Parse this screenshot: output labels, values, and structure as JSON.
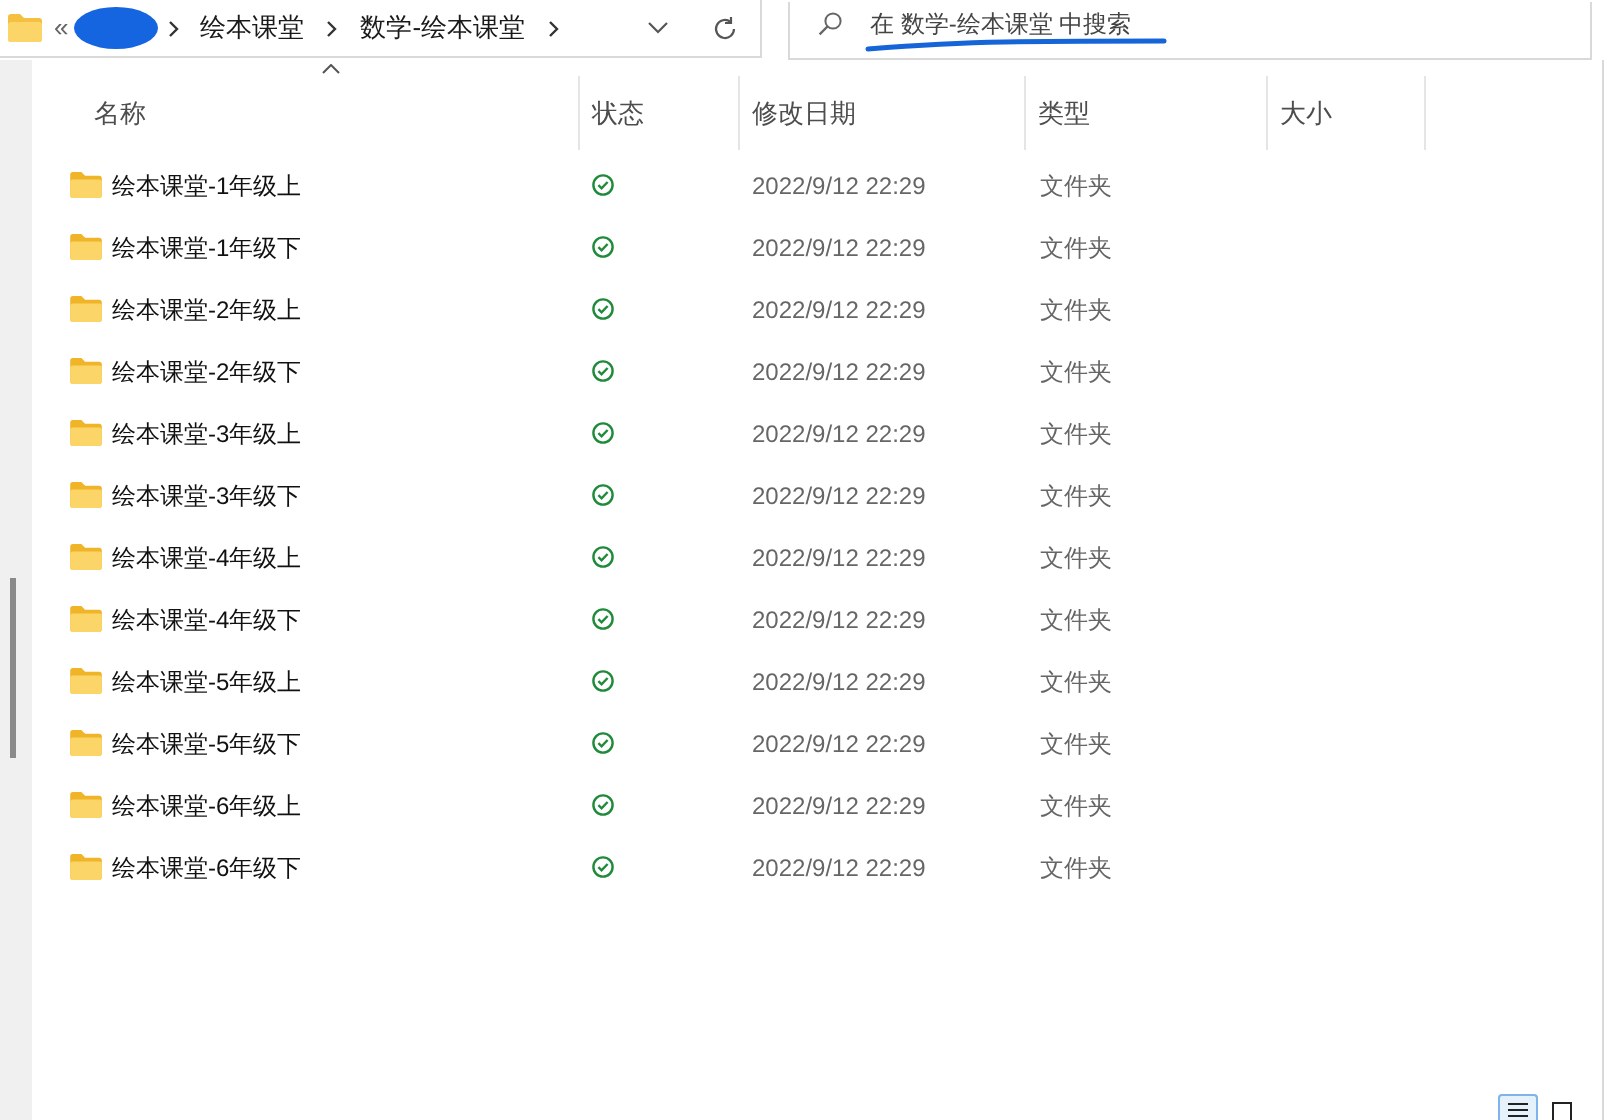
{
  "address_bar": {
    "overflow": "«",
    "segments": [
      "绘本课堂",
      "数学-绘本课堂"
    ]
  },
  "search": {
    "placeholder": "在 数学-绘本课堂 中搜索"
  },
  "columns": [
    {
      "label": "名称",
      "sorted": true
    },
    {
      "label": "状态",
      "sorted": false
    },
    {
      "label": "修改日期",
      "sorted": false
    },
    {
      "label": "类型",
      "sorted": false
    },
    {
      "label": "大小",
      "sorted": false
    }
  ],
  "rows": [
    {
      "name": "绘本课堂-1年级上",
      "synced": true,
      "modified": "2022/9/12 22:29",
      "type": "文件夹"
    },
    {
      "name": "绘本课堂-1年级下",
      "synced": true,
      "modified": "2022/9/12 22:29",
      "type": "文件夹"
    },
    {
      "name": "绘本课堂-2年级上",
      "synced": true,
      "modified": "2022/9/12 22:29",
      "type": "文件夹"
    },
    {
      "name": "绘本课堂-2年级下",
      "synced": true,
      "modified": "2022/9/12 22:29",
      "type": "文件夹"
    },
    {
      "name": "绘本课堂-3年级上",
      "synced": true,
      "modified": "2022/9/12 22:29",
      "type": "文件夹"
    },
    {
      "name": "绘本课堂-3年级下",
      "synced": true,
      "modified": "2022/9/12 22:29",
      "type": "文件夹"
    },
    {
      "name": "绘本课堂-4年级上",
      "synced": true,
      "modified": "2022/9/12 22:29",
      "type": "文件夹"
    },
    {
      "name": "绘本课堂-4年级下",
      "synced": true,
      "modified": "2022/9/12 22:29",
      "type": "文件夹"
    },
    {
      "name": "绘本课堂-5年级上",
      "synced": true,
      "modified": "2022/9/12 22:29",
      "type": "文件夹"
    },
    {
      "name": "绘本课堂-5年级下",
      "synced": true,
      "modified": "2022/9/12 22:29",
      "type": "文件夹"
    },
    {
      "name": "绘本课堂-6年级上",
      "synced": true,
      "modified": "2022/9/12 22:29",
      "type": "文件夹"
    },
    {
      "name": "绘本课堂-6年级下",
      "synced": true,
      "modified": "2022/9/12 22:29",
      "type": "文件夹"
    }
  ],
  "view_buttons": [
    {
      "kind": "details",
      "selected": true
    },
    {
      "kind": "tiles",
      "selected": false
    }
  ]
}
